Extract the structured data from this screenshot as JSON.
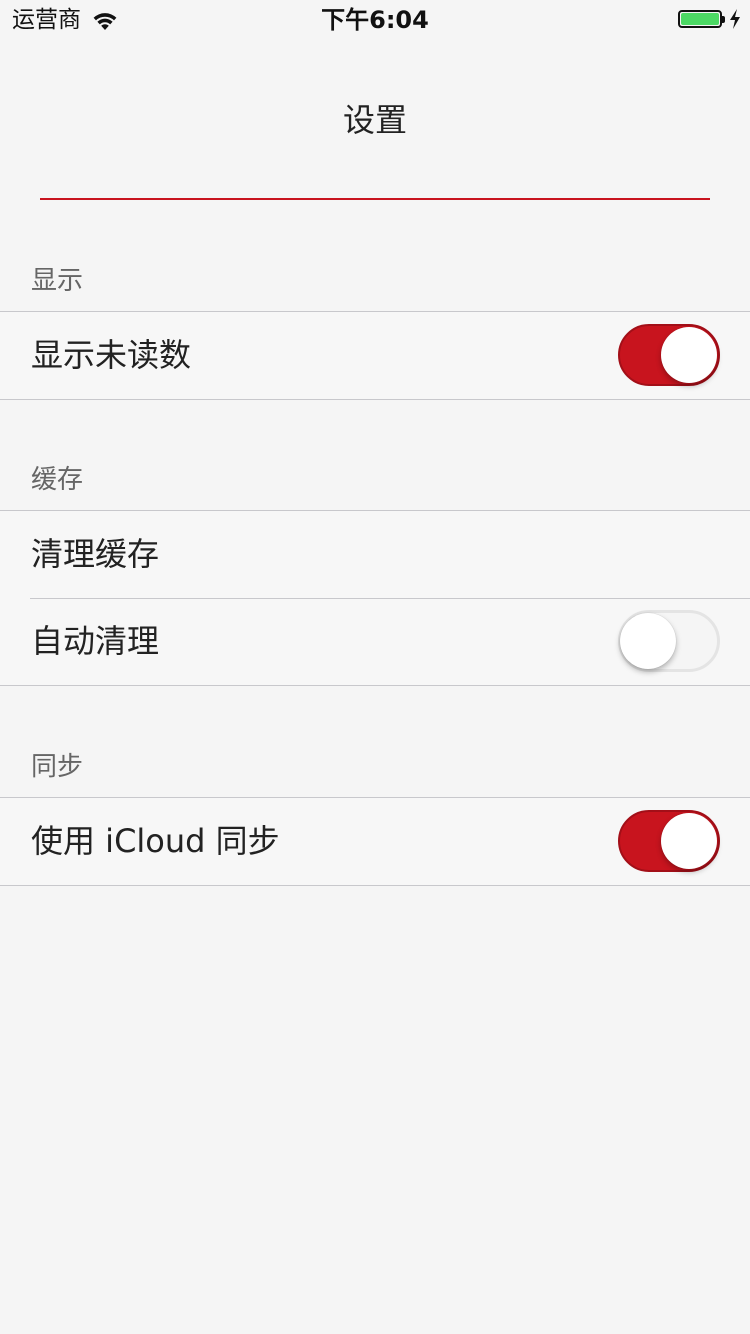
{
  "status_bar": {
    "carrier": "运营商",
    "time": "下午6:04",
    "battery_level": 1.0,
    "battery_color": "#4cd964",
    "charging": true,
    "icons": [
      "wifi-icon",
      "battery-icon",
      "charging-bolt-icon"
    ]
  },
  "nav": {
    "title": "设置",
    "accent_color": "#c8141e"
  },
  "sections": [
    {
      "header": "显示",
      "cells": [
        {
          "label": "显示未读数",
          "toggle": true
        }
      ]
    },
    {
      "header": "缓存",
      "cells": [
        {
          "label": "清理缓存"
        },
        {
          "label": "自动清理",
          "toggle": false
        }
      ]
    },
    {
      "header": "同步",
      "cells": [
        {
          "label": "使用 iCloud 同步",
          "toggle": true
        }
      ]
    }
  ]
}
